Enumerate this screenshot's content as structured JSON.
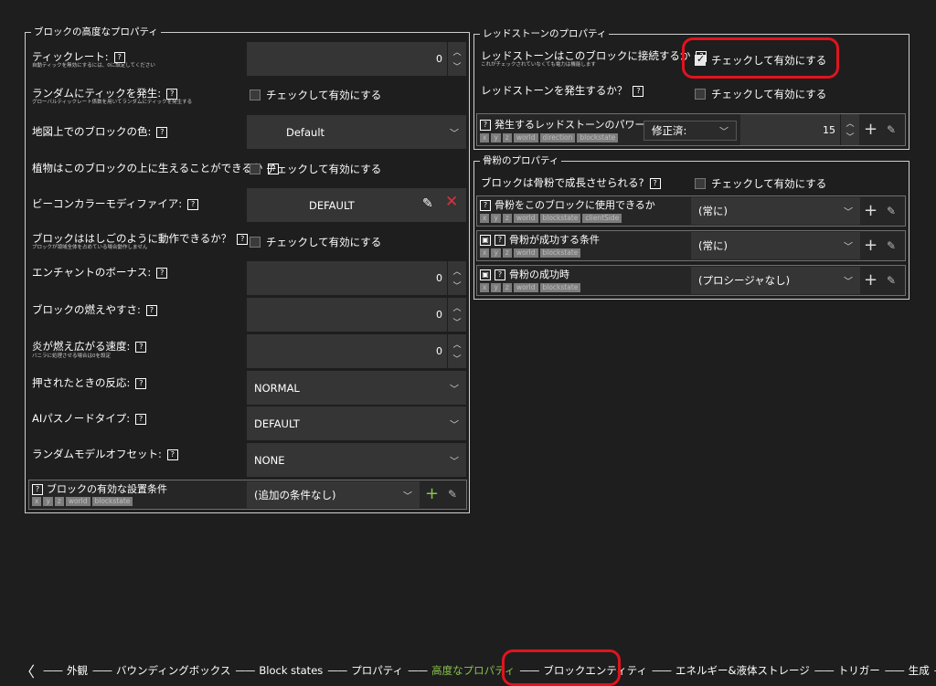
{
  "left_panel": {
    "title": "ブロックの高度なプロパティ",
    "tick_rate": {
      "label": "ティックレート:",
      "sub": "自動ティックを無効にするには、0に設定してください",
      "value": "0"
    },
    "random_tick": {
      "label": "ランダムにティックを発生:",
      "sub": "グローバルティックレート係数を用いてランダムにティックを発生する",
      "check": "チェックして有効にする"
    },
    "map_color": {
      "label": "地図上でのブロックの色:",
      "value": "Default"
    },
    "plants_sustain": {
      "label": "植物はこのブロックの上に生えることができるか",
      "check": "チェックして有効にする"
    },
    "beacon": {
      "label": "ビーコンカラーモディファイア:",
      "value": "DEFAULT"
    },
    "ladder": {
      "label": "ブロックははしごのように動作できるか？",
      "sub": "ブロックが領域全体を占めている場合動作しません",
      "check": "チェックして有効にする"
    },
    "enchant": {
      "label": "エンチャントのボーナス:",
      "value": "0"
    },
    "flammability": {
      "label": "ブロックの燃えやすさ:",
      "value": "0"
    },
    "fire_spread": {
      "label": "炎が燃え広がる速度:",
      "sub": "バニラに処理させる場合は0を設定",
      "value": "0"
    },
    "push_reaction": {
      "label": "押されたときの反応:",
      "value": "NORMAL"
    },
    "ai_path": {
      "label": "AIパスノードタイプ:",
      "value": "DEFAULT"
    },
    "model_offset": {
      "label": "ランダムモデルオフセット:",
      "value": "NONE"
    },
    "placement": {
      "label": "ブロックの有効な設置条件",
      "deps": [
        "x",
        "y",
        "z",
        "world",
        "blockstate"
      ],
      "value": "(追加の条件なし)"
    }
  },
  "redstone_panel": {
    "title": "レッドストーンのプロパティ",
    "connect": {
      "label": "レッドストーンはこのブロックに接続するか",
      "sub": "これがチェックされていなくても電力は機能します",
      "check": "チェックして有効にする",
      "checked": true
    },
    "emit": {
      "label": "レッドストーンを発生するか？",
      "check": "チェックして有効にする"
    },
    "power": {
      "label": "発生するレッドストーンのパワー:",
      "deps": [
        "x",
        "y",
        "z",
        "world",
        "direction",
        "blockstate"
      ],
      "mode": "修正済:",
      "value": "15"
    }
  },
  "bonemeal_panel": {
    "title": "骨粉のプロパティ",
    "growable": {
      "label": "ブロックは骨粉で成長させられる?",
      "check": "チェックして有効にする"
    },
    "can_use": {
      "label": "骨粉をこのブロックに使用できるか",
      "deps": [
        "x",
        "y",
        "z",
        "world",
        "blockstate",
        "clientSide"
      ],
      "value": "(常に)"
    },
    "success_cond": {
      "label": "骨粉が成功する条件",
      "deps": [
        "x",
        "y",
        "z",
        "world",
        "blockstate"
      ],
      "value": "(常に)"
    },
    "on_success": {
      "label": "骨粉の成功時",
      "deps": [
        "x",
        "y",
        "z",
        "world",
        "blockstate"
      ],
      "value": "(プロシージャなし)"
    }
  },
  "nav": {
    "items": [
      "外観",
      "バウンディングボックス",
      "Block states",
      "プロパティ",
      "高度なプロパティ",
      "ブロックエンティティ",
      "エネルギー&液体ストレージ",
      "トリガー",
      "生成"
    ],
    "active_index": 4
  },
  "colors": {
    "accent": "#8ac34a",
    "highlight": "#e0141e",
    "background": "#1e1e1e"
  }
}
